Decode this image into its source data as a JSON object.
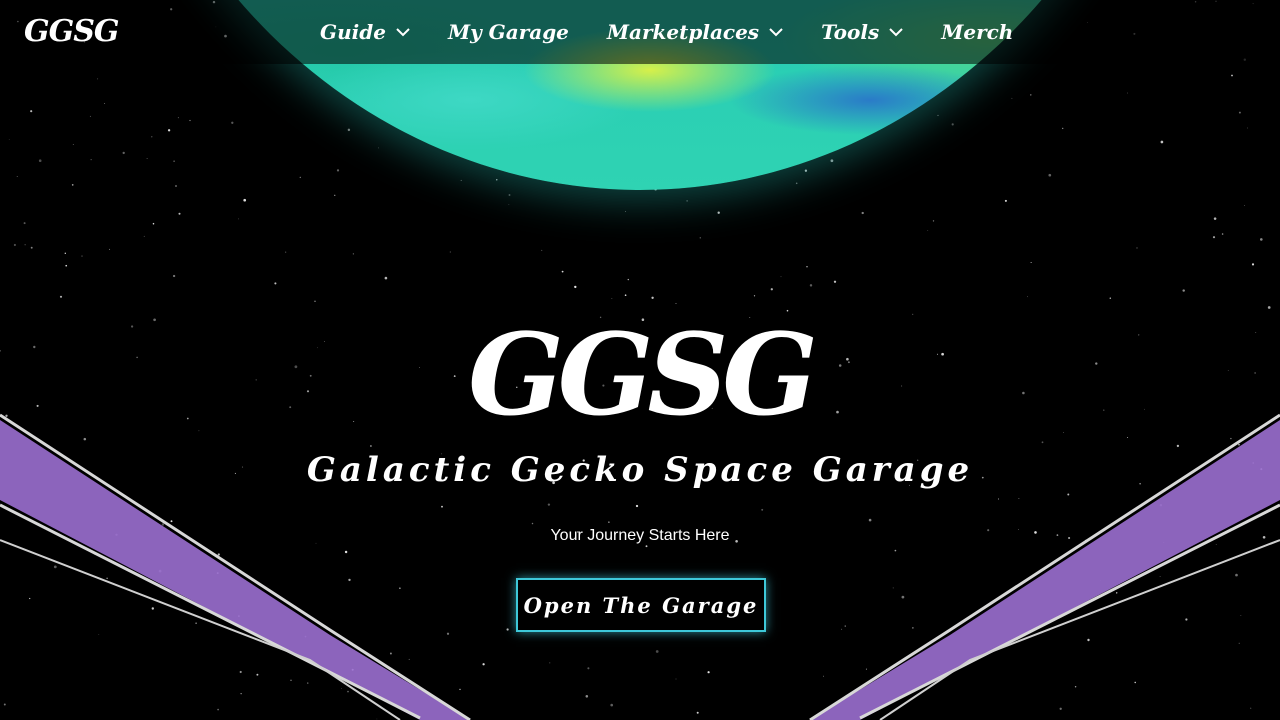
{
  "brand": {
    "logo_text": "GGSG"
  },
  "nav": {
    "items": [
      {
        "label": "Guide",
        "has_dropdown": true
      },
      {
        "label": "My Garage",
        "has_dropdown": false
      },
      {
        "label": "Marketplaces",
        "has_dropdown": true
      },
      {
        "label": "Tools",
        "has_dropdown": true
      },
      {
        "label": "Merch",
        "has_dropdown": false
      }
    ]
  },
  "hero": {
    "logo_text": "GGSG",
    "title": "Galactic Gecko Space Garage",
    "subtitle": "Your Journey Starts Here",
    "cta_label": "Open The Garage"
  },
  "colors": {
    "background": "#000000",
    "accent_cyan": "#3ec8d9",
    "planet_teal": "#21c6b5",
    "wing_purple": "#9b6fd0"
  }
}
